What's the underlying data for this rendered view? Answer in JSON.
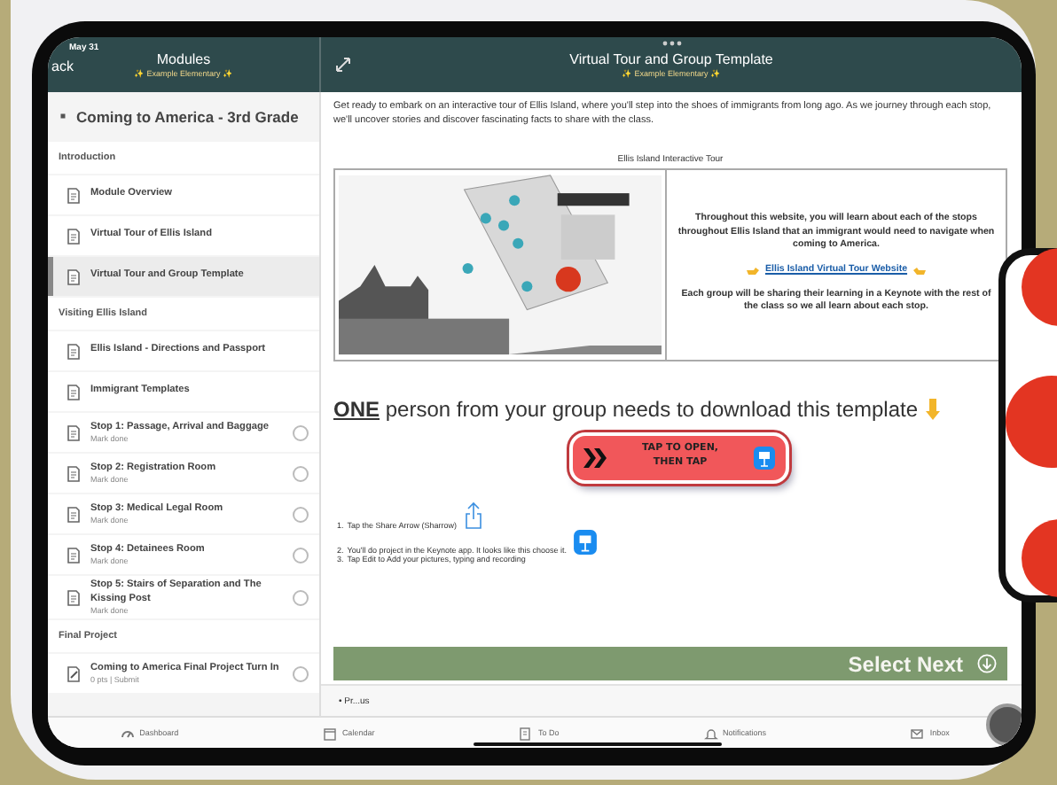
{
  "status_bar": {
    "date": "May 31"
  },
  "sidebar_header": {
    "back": "ack",
    "title": "Modules",
    "subtitle": "✨ Example Elementary ✨"
  },
  "content_header": {
    "title": "Virtual Tour and Group Template",
    "subtitle": "✨ Example Elementary ✨"
  },
  "module": {
    "title": "Coming to America - 3rd Grade",
    "expanded": true,
    "items": [
      {
        "kind": "section",
        "label": "Introduction"
      },
      {
        "kind": "page",
        "label": "Module Overview",
        "selected": false
      },
      {
        "kind": "page",
        "label": "Virtual Tour of Ellis Island",
        "selected": false
      },
      {
        "kind": "page",
        "label": "Virtual Tour and Group Template",
        "selected": true
      },
      {
        "kind": "section",
        "label": "Visiting Ellis Island"
      },
      {
        "kind": "page",
        "label": "Ellis Island - Directions and Passport",
        "selected": false
      },
      {
        "kind": "page",
        "label": "Immigrant Templates",
        "selected": false
      },
      {
        "kind": "page",
        "label": "Stop 1: Passage, Arrival and Baggage",
        "sub": "Mark done",
        "done": false,
        "selected": false
      },
      {
        "kind": "page",
        "label": "Stop 2: Registration Room",
        "sub": "Mark done",
        "done": false,
        "selected": false
      },
      {
        "kind": "page",
        "label": "Stop 3: Medical Legal Room",
        "sub": "Mark done",
        "done": false,
        "selected": false
      },
      {
        "kind": "page",
        "label": "Stop 4: Detainees Room",
        "sub": "Mark done",
        "done": false,
        "selected": false
      },
      {
        "kind": "page",
        "label": "Stop 5: Stairs of Separation and The Kissing Post",
        "sub": "Mark done",
        "done": false,
        "selected": false
      },
      {
        "kind": "section",
        "label": "Final Project"
      },
      {
        "kind": "assignment",
        "label": "Coming to America Final Project Turn In",
        "sub": "0 pts | Submit",
        "done": false,
        "selected": false
      }
    ]
  },
  "intro": "Get ready to embark on an interactive tour of Ellis Island, where you'll step into the shoes of immigrants from long ago. As we journey through each stop, we'll uncover stories and discover fascinating facts to share with the class.",
  "tour": {
    "caption": "Ellis Island Interactive Tour",
    "picture": {
      "kind": "picture"
    },
    "paragraphs": [
      "Throughout this website, you will learn about each of the stops throughout Ellis Island that an immigrant would need to navigate when coming to America.",
      "Each group will be sharing their learning in a Keynote with the rest of the class so we all learn about each stop."
    ],
    "link": "Ellis Island Virtual Tour Website"
  },
  "download": "**ONE** person from your group needs to download this template",
  "open_button": {
    "line_1": "TAP TO OPEN,",
    "line_2": "THEN TAP"
  },
  "steps": [
    {
      "number": "1.",
      "text": "Tap the Share Arrow (Sharrow)",
      "kind": "share"
    },
    {
      "number": "2.",
      "text": "You'll do project in the Keynote app.  It looks like this choose it.",
      "kind": "keynote"
    },
    {
      "number": "3.",
      "text": "Tap Edit  to Add your pictures, typing and recording"
    }
  ],
  "next_banner": "Select Next",
  "previous": "• Pr...us",
  "tab_bar": [
    {
      "kind": "dashboard",
      "label": "Dashboard"
    },
    {
      "kind": "calendar",
      "label": "Calendar"
    },
    {
      "kind": "todo",
      "label": "To Do"
    },
    {
      "kind": "notifications",
      "label": "Notifications"
    },
    {
      "kind": "inbox",
      "label": "Inbox"
    }
  ]
}
